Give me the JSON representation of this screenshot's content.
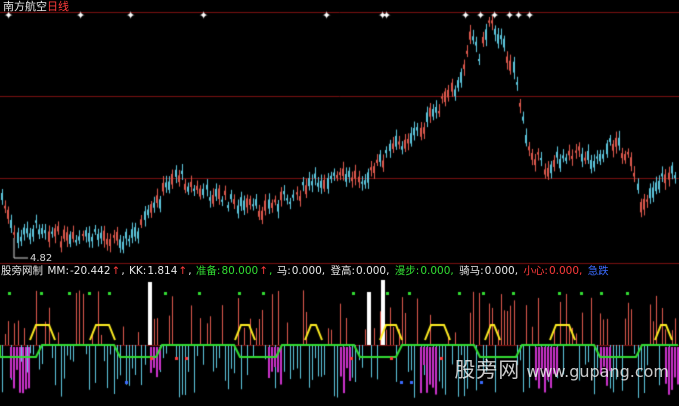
{
  "header": {
    "stock_name": "南方航空",
    "period": "日线",
    "colors": {
      "stock_name": "#e8e8e8",
      "period": "#ff3b3b"
    }
  },
  "main_chart": {
    "low_label": "4.82",
    "up_color": "#e05a4e",
    "down_color": "#5ec9e0",
    "grid_color": "#7a1010"
  },
  "indicator": {
    "name": "股旁网制",
    "fields": [
      {
        "label": "MM:",
        "value": "-20.442",
        "arrow": "↑",
        "color": "#e8e8e8"
      },
      {
        "label": "KK:",
        "value": "1.814",
        "arrow": "↑",
        "color": "#e8e8e8"
      },
      {
        "label": "准备:",
        "value": "80.000",
        "arrow": "↑",
        "color": "#33dd33"
      },
      {
        "label": "马:",
        "value": "0.000,",
        "arrow": "",
        "color": "#e8e8e8"
      },
      {
        "label": "登高:",
        "value": "0.000,",
        "arrow": "",
        "color": "#e8e8e8"
      },
      {
        "label": "漫步:",
        "value": "0.000,",
        "arrow": "",
        "color": "#33dd33"
      },
      {
        "label": "骑马:",
        "value": "0.000,",
        "arrow": "",
        "color": "#e8e8e8"
      },
      {
        "label": "小心:",
        "value": "0.000,",
        "arrow": "",
        "color": "#ff3b3b"
      },
      {
        "label": "急跌",
        "value": "",
        "arrow": "",
        "color": "#3b6bff"
      }
    ]
  },
  "watermark": {
    "cn": "股旁网",
    "en": "www.gupang.com"
  }
}
